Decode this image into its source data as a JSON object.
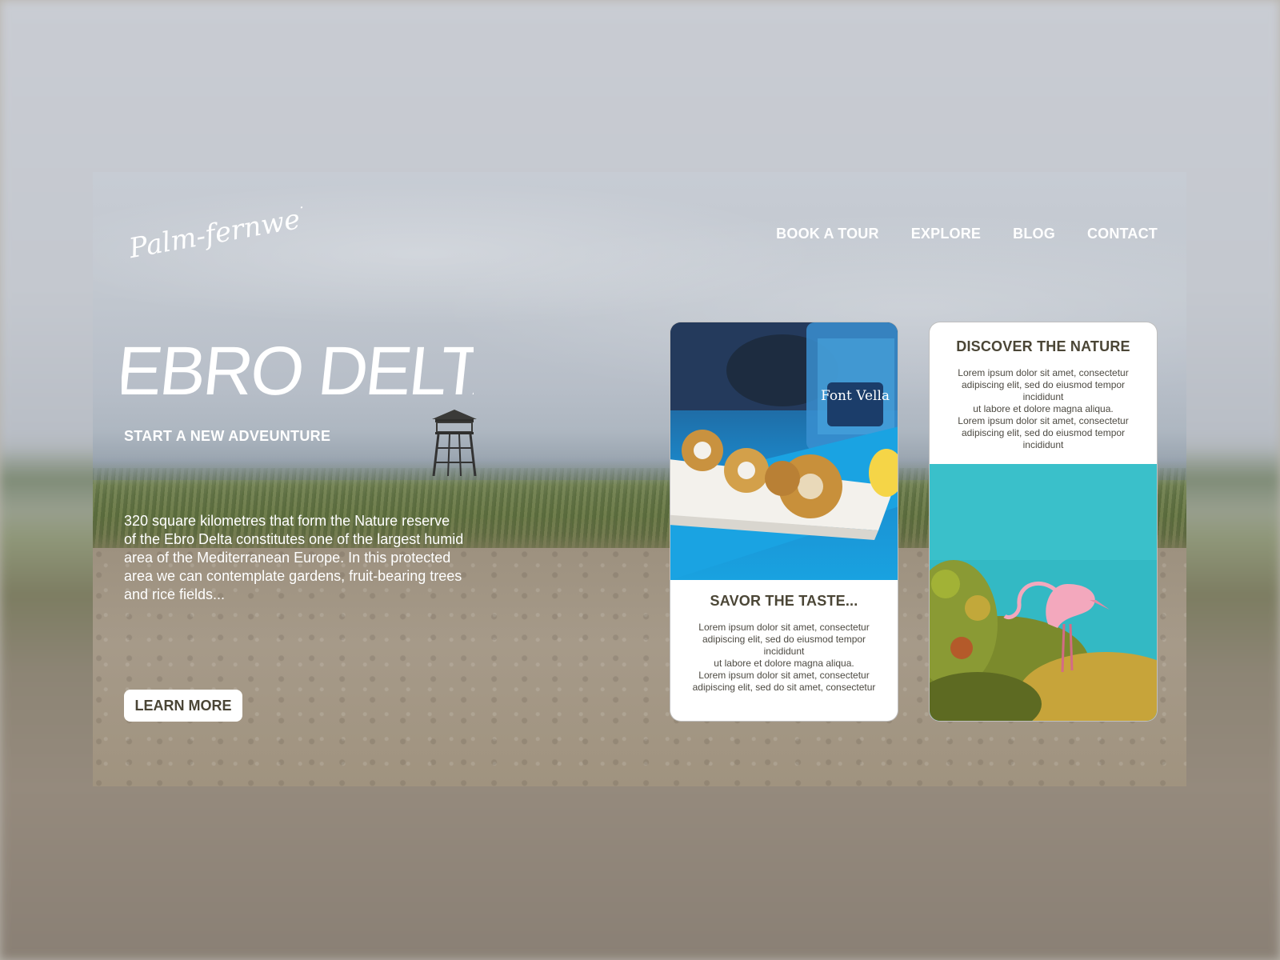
{
  "brand": {
    "logo_text": "Palm-fernweh"
  },
  "nav": {
    "items": [
      {
        "label": "BOOK A TOUR"
      },
      {
        "label": "EXPLORE"
      },
      {
        "label": "BLOG"
      },
      {
        "label": "CONTACT"
      }
    ]
  },
  "hero": {
    "title": "EBRO DELTA",
    "subtitle": "START A NEW ADVEUNTURE",
    "description": "320 square kilometres that form the Nature reserve of the Ebro Delta constitutes one of the largest humid area of the Mediterranean Europe. In this protected area we can contemplate gardens, fruit-bearing trees and rice fields...",
    "cta_label": "LEARN MORE"
  },
  "cards": [
    {
      "title": "SAVOR THE TASTE...",
      "text": "Lorem ipsum dolor sit amet, consectetur adipiscing elit, sed do eiusmod tempor incididunt\nut labore et dolore magna aliqua.\nLorem ipsum dolor sit amet, consectetur adipiscing elit, sed do  sit amet, consectetur",
      "image_text": "Font Vella"
    },
    {
      "title": "DISCOVER THE NATURE",
      "text": "Lorem ipsum dolor sit amet, consectetur adipiscing elit, sed do eiusmod tempor incididunt\nut labore et dolore magna aliqua.\nLorem ipsum dolor sit amet, consectetur adipiscing elit, sed do eiusmod tempor incididunt"
    }
  ],
  "colors": {
    "text_dark": "#4b4636",
    "white": "#ffffff",
    "water_blue": "#19a2e0",
    "lagoon_teal": "#2fb8c2"
  }
}
